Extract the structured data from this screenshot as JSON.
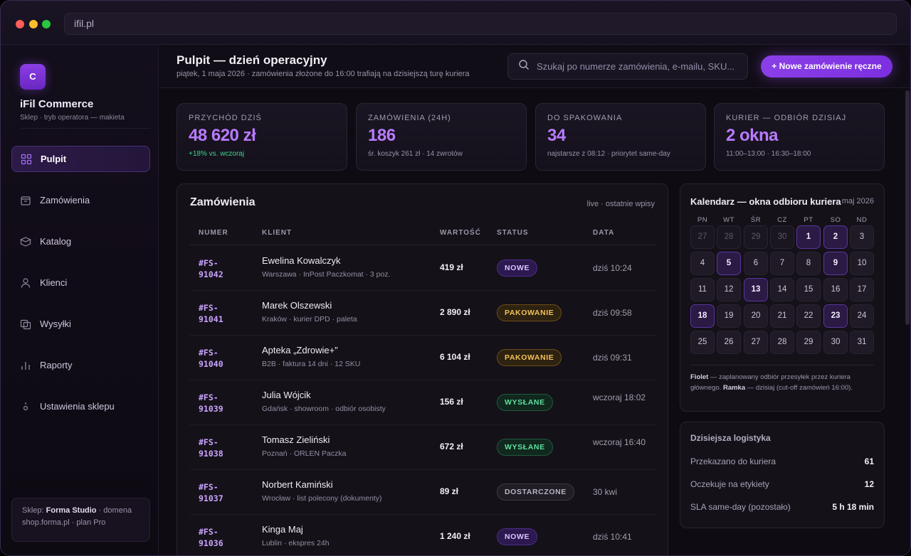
{
  "browser": {
    "url": "ifil.pl"
  },
  "brand": {
    "logo_letter": "C",
    "name": "iFil Commerce",
    "subtitle": "Sklep · tryb operatora — makieta"
  },
  "nav": [
    {
      "label": "Pulpit",
      "icon": "grid-icon",
      "active": true
    },
    {
      "label": "Zamówienia",
      "icon": "box-icon"
    },
    {
      "label": "Katalog",
      "icon": "catalog-icon"
    },
    {
      "label": "Klienci",
      "icon": "user-icon"
    },
    {
      "label": "Wysyłki",
      "icon": "shipping-icon"
    },
    {
      "label": "Raporty",
      "icon": "bar-chart-icon"
    },
    {
      "label": "Ustawienia sklepu",
      "icon": "settings-icon"
    }
  ],
  "shop_card": {
    "prefix": "Sklep: ",
    "shop": "Forma Studio",
    "line1_suffix": " · domena",
    "line2": "shop.forma.pl · plan Pro"
  },
  "header": {
    "title": "Pulpit — dzień operacyjny",
    "subtitle": "piątek, 1 maja 2026 · zamówienia złożone do 16:00 trafiają na dzisiejszą turę kuriera",
    "search_placeholder": "Szukaj po numerze zamówienia, e-mailu, SKU...",
    "new_order_label": "+ Nowe zamówienie ręczne"
  },
  "stats": [
    {
      "label": "Przychód dziś",
      "value": "48 620 zł",
      "note": "+18% vs. wczoraj",
      "note_color": "#3fd68c"
    },
    {
      "label": "Zamówienia (24h)",
      "value": "186",
      "note": "śr. koszyk 261 zł · 14 zwrotów"
    },
    {
      "label": "Do spakowania",
      "value": "34",
      "note": "najstarsze z 08:12 · priorytet same-day"
    },
    {
      "label": "Kurier — odbiór dzisiaj",
      "value": "2 okna",
      "note": "11:00–13:00 · 16:30–18:00"
    }
  ],
  "orders": {
    "title": "Zamówienia",
    "live_label": "live · ostatnie wpisy",
    "columns": [
      "NUMER",
      "KLIENT",
      "WARTOŚĆ",
      "STATUS",
      "DATA"
    ],
    "rows": [
      {
        "id": "#FS-91042",
        "client": "Ewelina Kowalczyk",
        "detail": "Warszawa · InPost Paczkomat · 3 poz.",
        "value": "419 zł",
        "status": "NOWE",
        "status_type": "nowe",
        "date": "dziś 10:24"
      },
      {
        "id": "#FS-91041",
        "client": "Marek Olszewski",
        "detail": "Kraków · kurier DPD · paleta",
        "value": "2 890 zł",
        "status": "PAKOWANIE",
        "status_type": "pak",
        "date": "dziś 09:58"
      },
      {
        "id": "#FS-91040",
        "client": "Apteka „Zdrowie+”",
        "detail": "B2B · faktura 14 dni · 12 SKU",
        "value": "6 104 zł",
        "status": "PAKOWANIE",
        "status_type": "pak",
        "date": "dziś 09:31"
      },
      {
        "id": "#FS-91039",
        "client": "Julia Wójcik",
        "detail": "Gdańsk · showroom · odbiór osobisty",
        "value": "156 zł",
        "status": "WYSŁANE",
        "status_type": "wys",
        "date": "wczoraj 18:02"
      },
      {
        "id": "#FS-91038",
        "client": "Tomasz Zieliński",
        "detail": "Poznań · ORLEN Paczka",
        "value": "672 zł",
        "status": "WYSŁANE",
        "status_type": "wys",
        "date": "wczoraj 16:40"
      },
      {
        "id": "#FS-91037",
        "client": "Norbert Kamiński",
        "detail": "Wrocław · list polecony (dokumenty)",
        "value": "89 zł",
        "status": "DOSTARCZONE",
        "status_type": "dos",
        "date": "30 kwi"
      },
      {
        "id": "#FS-91036",
        "client": "Kinga Maj",
        "detail": "Lublin · ekspres 24h",
        "value": "1 240 zł",
        "status": "NOWE",
        "status_type": "nowe",
        "date": "dziś 10:41"
      }
    ]
  },
  "calendar": {
    "title": "Kalendarz — okna odbioru kuriera",
    "month": "maj 2026",
    "weekdays": [
      "PN",
      "WT",
      "ŚR",
      "CZ",
      "PT",
      "SO",
      "ND"
    ],
    "days": [
      {
        "d": "27",
        "m": true
      },
      {
        "d": "28",
        "m": true
      },
      {
        "d": "29",
        "m": true
      },
      {
        "d": "30",
        "m": true
      },
      {
        "d": "1",
        "p": true
      },
      {
        "d": "2",
        "p": true
      },
      {
        "d": "3"
      },
      {
        "d": "4"
      },
      {
        "d": "5",
        "p": true
      },
      {
        "d": "6"
      },
      {
        "d": "7"
      },
      {
        "d": "8"
      },
      {
        "d": "9",
        "p": true
      },
      {
        "d": "10"
      },
      {
        "d": "11"
      },
      {
        "d": "12"
      },
      {
        "d": "13",
        "p": true
      },
      {
        "d": "14"
      },
      {
        "d": "15"
      },
      {
        "d": "16"
      },
      {
        "d": "17"
      },
      {
        "d": "18",
        "p": true
      },
      {
        "d": "19"
      },
      {
        "d": "20"
      },
      {
        "d": "21"
      },
      {
        "d": "22"
      },
      {
        "d": "23",
        "p": true
      },
      {
        "d": "24"
      },
      {
        "d": "25"
      },
      {
        "d": "26"
      },
      {
        "d": "27"
      },
      {
        "d": "28"
      },
      {
        "d": "29"
      },
      {
        "d": "30"
      },
      {
        "d": "31"
      }
    ],
    "legend_bold1": "Fiolet",
    "legend_text1": " — zaplanowany odbiór przesyłek przez kuriera głównego. ",
    "legend_bold2": "Ramka",
    "legend_text2": " — dzisiaj (cut-off zamówień 16:00)."
  },
  "logistics": {
    "title": "Dzisiejsza logistyka",
    "rows": [
      {
        "label": "Przekazano do kuriera",
        "value": "61"
      },
      {
        "label": "Oczekuje na etykiety",
        "value": "12"
      },
      {
        "label": "SLA same-day (pozostało)",
        "value": "5 h 18 min"
      }
    ]
  }
}
